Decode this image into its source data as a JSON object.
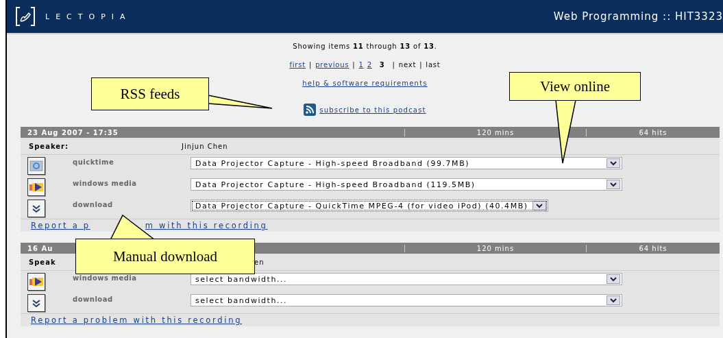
{
  "header": {
    "logo_text": "LECTOPIA",
    "title": "Web Programming :: HIT3323"
  },
  "paging": {
    "summary": "Showing items **11** through **13** of **13**.",
    "items": [
      {
        "kind": "link",
        "label": "first",
        "disabled": false
      },
      {
        "kind": "separator",
        "label": "|"
      },
      {
        "kind": "link",
        "label": "previous",
        "disabled": false
      },
      {
        "kind": "separator",
        "label": "|"
      },
      {
        "kind": "page",
        "label": "1",
        "selected": false
      },
      {
        "kind": "page",
        "label": "2",
        "selected": false
      },
      {
        "kind": "page",
        "label": "3",
        "selected": true
      },
      {
        "kind": "separator",
        "label": "|"
      },
      {
        "kind": "link",
        "label": "next",
        "disabled": true
      },
      {
        "kind": "separator",
        "label": "|"
      },
      {
        "kind": "link",
        "label": "last",
        "disabled": true
      }
    ]
  },
  "help_link": "help & software requirements",
  "subscribe_link": "subscribe to this podcast",
  "recordings": [
    {
      "date": "23 Aug 2007 - 17:35",
      "duration": "120 mins",
      "hits": "64 hits",
      "speaker_label": "Speaker:",
      "speaker": "Jinjun Chen",
      "formats": [
        {
          "kind": "quicktime",
          "label": "quicktime",
          "value": "Data Projector Capture - High-speed Broadband (99.7MB)",
          "focused": false
        },
        {
          "kind": "windows-media",
          "label": "windows media",
          "value": "Data Projector Capture - High-speed Broadband (119.5MB)",
          "focused": false
        },
        {
          "kind": "download",
          "label": "download",
          "value": "Data Projector Capture - QuickTime MPEG-4 (for video iPod) (40.4MB)",
          "focused": true
        }
      ],
      "report_parts": [
        "Report a p",
        "m with this recording"
      ]
    },
    {
      "date": "16 Au",
      "duration": "120 mins",
      "hits": "64 hits",
      "speaker_label": "Speak",
      "speaker": "en",
      "formats": [
        {
          "kind": "windows-media",
          "label": "windows media",
          "value": "select bandwidth...",
          "focused": false
        },
        {
          "kind": "download",
          "label": "download",
          "value": "select bandwidth...",
          "focused": false
        }
      ],
      "report_parts": [
        "Report a problem with this recording"
      ]
    }
  ],
  "callouts": [
    {
      "text": "RSS feeds"
    },
    {
      "text": "View online"
    },
    {
      "text": "Manual download"
    }
  ]
}
